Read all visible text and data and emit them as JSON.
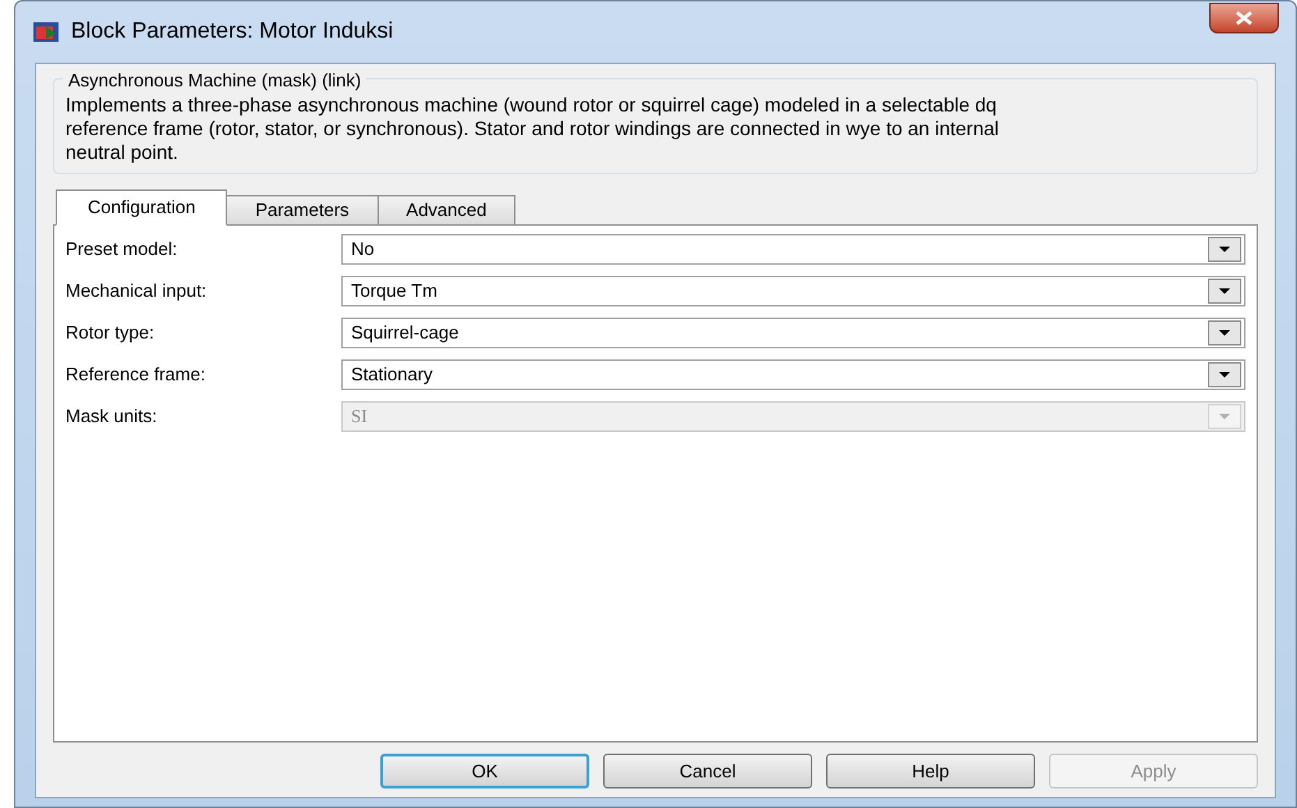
{
  "window": {
    "title": "Block Parameters: Motor Induksi"
  },
  "group": {
    "title": "Asynchronous Machine (mask) (link)",
    "description": "Implements a three-phase asynchronous machine (wound rotor or squirrel cage) modeled in a selectable  dq reference frame (rotor, stator, or synchronous). Stator and rotor windings are connected in wye to an internal neutral point."
  },
  "tabs": [
    {
      "label": "Configuration",
      "selected": true
    },
    {
      "label": "Parameters",
      "selected": false
    },
    {
      "label": "Advanced",
      "selected": false
    }
  ],
  "fields": [
    {
      "label": "Preset model:",
      "value": "No",
      "disabled": false
    },
    {
      "label": "Mechanical input:",
      "value": "Torque Tm",
      "disabled": false
    },
    {
      "label": "Rotor type:",
      "value": "Squirrel-cage",
      "disabled": false
    },
    {
      "label": "Reference frame:",
      "value": "Stationary",
      "disabled": false
    },
    {
      "label": "Mask units:",
      "value": "SI",
      "disabled": true
    }
  ],
  "buttons": [
    {
      "label": "OK",
      "disabled": false,
      "focused": true
    },
    {
      "label": "Cancel",
      "disabled": false,
      "focused": false
    },
    {
      "label": "Help",
      "disabled": false,
      "focused": false
    },
    {
      "label": "Apply",
      "disabled": true,
      "focused": false
    }
  ]
}
